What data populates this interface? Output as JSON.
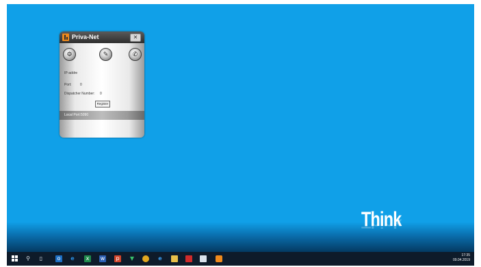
{
  "widget": {
    "title": "Priva-Net",
    "close_glyph": "✕",
    "toolbar": {
      "settings_icon": "gear-icon",
      "edit_icon": "edit-icon",
      "phone_icon": "phone-icon"
    },
    "fields": {
      "ip_label": "IP-addre",
      "port_label": "Port:",
      "port_value": "0",
      "dispatcher_label": "Dispatcher Number:",
      "dispatcher_value": "0",
      "register_label": "Register",
      "local_port_label": "Local Port:",
      "local_port_value": "5090"
    },
    "colors": {
      "title_bar": "#3a3a3a",
      "logo": "#f08a1c"
    }
  },
  "desktop": {
    "background_color": "#10a0e8",
    "brand_text": "Think"
  },
  "taskbar": {
    "pinned_icons": [
      "start-icon",
      "search-icon",
      "task-view-icon",
      "outlook-icon",
      "edge-icon",
      "excel-icon",
      "word-icon",
      "powerpoint-icon",
      "vpn-icon",
      "chrome-icon",
      "ie-icon",
      "file-explorer-icon",
      "acrobat-icon",
      "window-icon",
      "priva-net-icon"
    ],
    "clock": {
      "time": "17:35",
      "date": "09.04.2019"
    }
  }
}
